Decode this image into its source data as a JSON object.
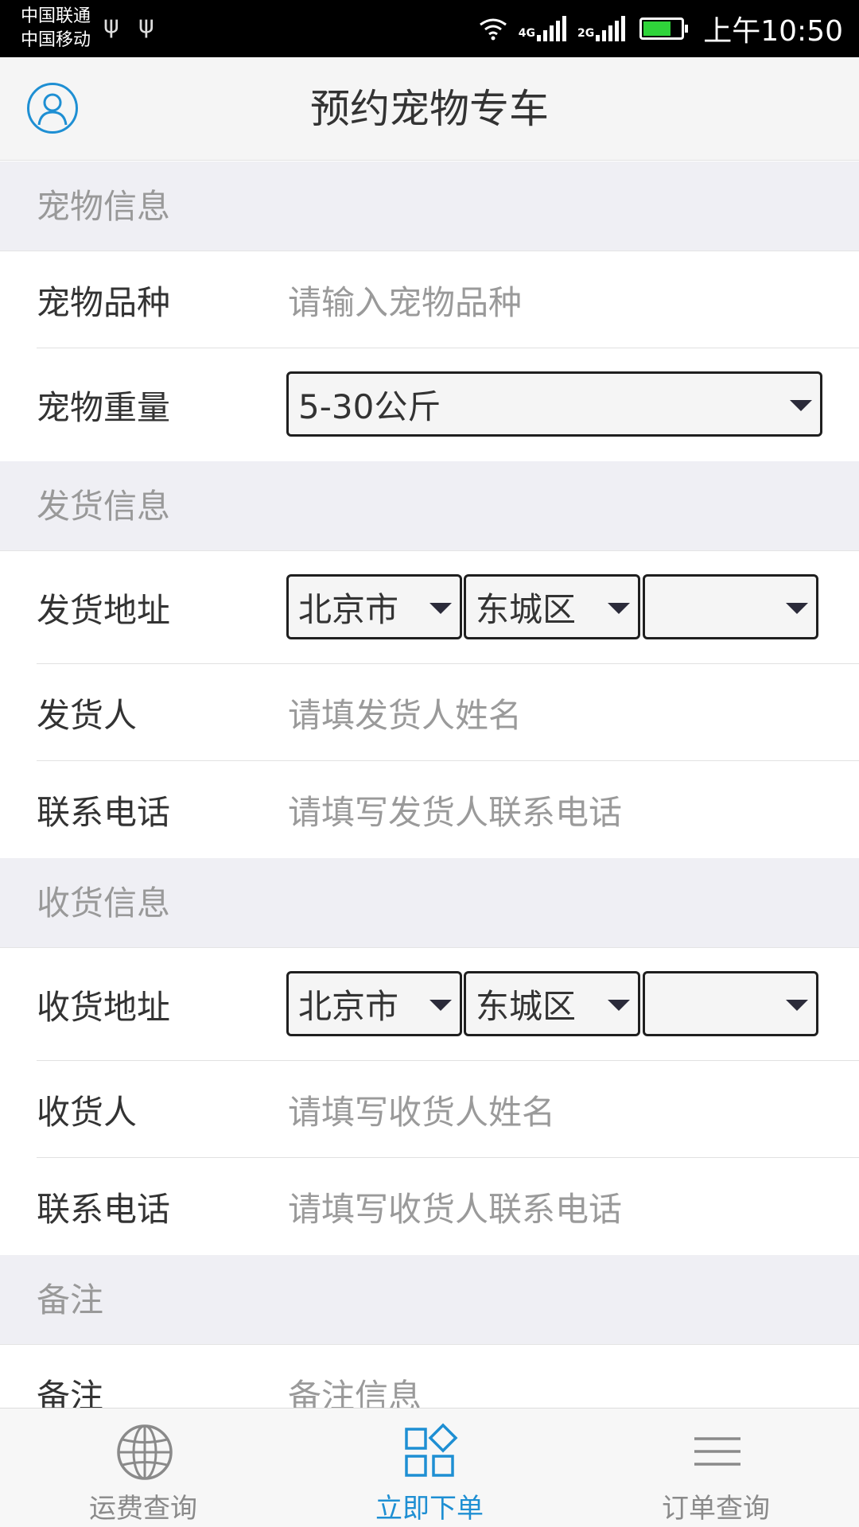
{
  "status_bar": {
    "carrier_1": "中国联通",
    "carrier_2": "中国移动",
    "net_1": "4G",
    "net_2": "2G",
    "time": "上午10:50"
  },
  "header": {
    "title": "预约宠物专车",
    "avatar_icon": "user-avatar-icon"
  },
  "sections": {
    "pet": {
      "heading": "宠物信息",
      "breed_label": "宠物品种",
      "breed_placeholder": "请输入宠物品种",
      "weight_label": "宠物重量",
      "weight_value": "5-30公斤"
    },
    "shipper": {
      "heading": "发货信息",
      "address_label": "发货地址",
      "city": "北京市",
      "district": "东城区",
      "street": "",
      "name_label": "发货人",
      "name_placeholder": "请填发货人姓名",
      "phone_label": "联系电话",
      "phone_placeholder": "请填写发货人联系电话"
    },
    "receiver": {
      "heading": "收货信息",
      "address_label": "收货地址",
      "city": "北京市",
      "district": "东城区",
      "street": "",
      "name_label": "收货人",
      "name_placeholder": "请填写收货人姓名",
      "phone_label": "联系电话",
      "phone_placeholder": "请填写收货人联系电话"
    },
    "remark": {
      "heading": "备注",
      "label": "备注",
      "placeholder": "备注信息"
    }
  },
  "tabbar": {
    "tabs": [
      {
        "label": "运费查询",
        "icon": "globe-icon",
        "active": false
      },
      {
        "label": "立即下单",
        "icon": "grid-diamond-icon",
        "active": true
      },
      {
        "label": "订单查询",
        "icon": "menu-lines-icon",
        "active": false
      }
    ]
  },
  "colors": {
    "accent": "#1e8fd3",
    "section_bg": "#efeff4",
    "placeholder": "#9a9a9a"
  }
}
